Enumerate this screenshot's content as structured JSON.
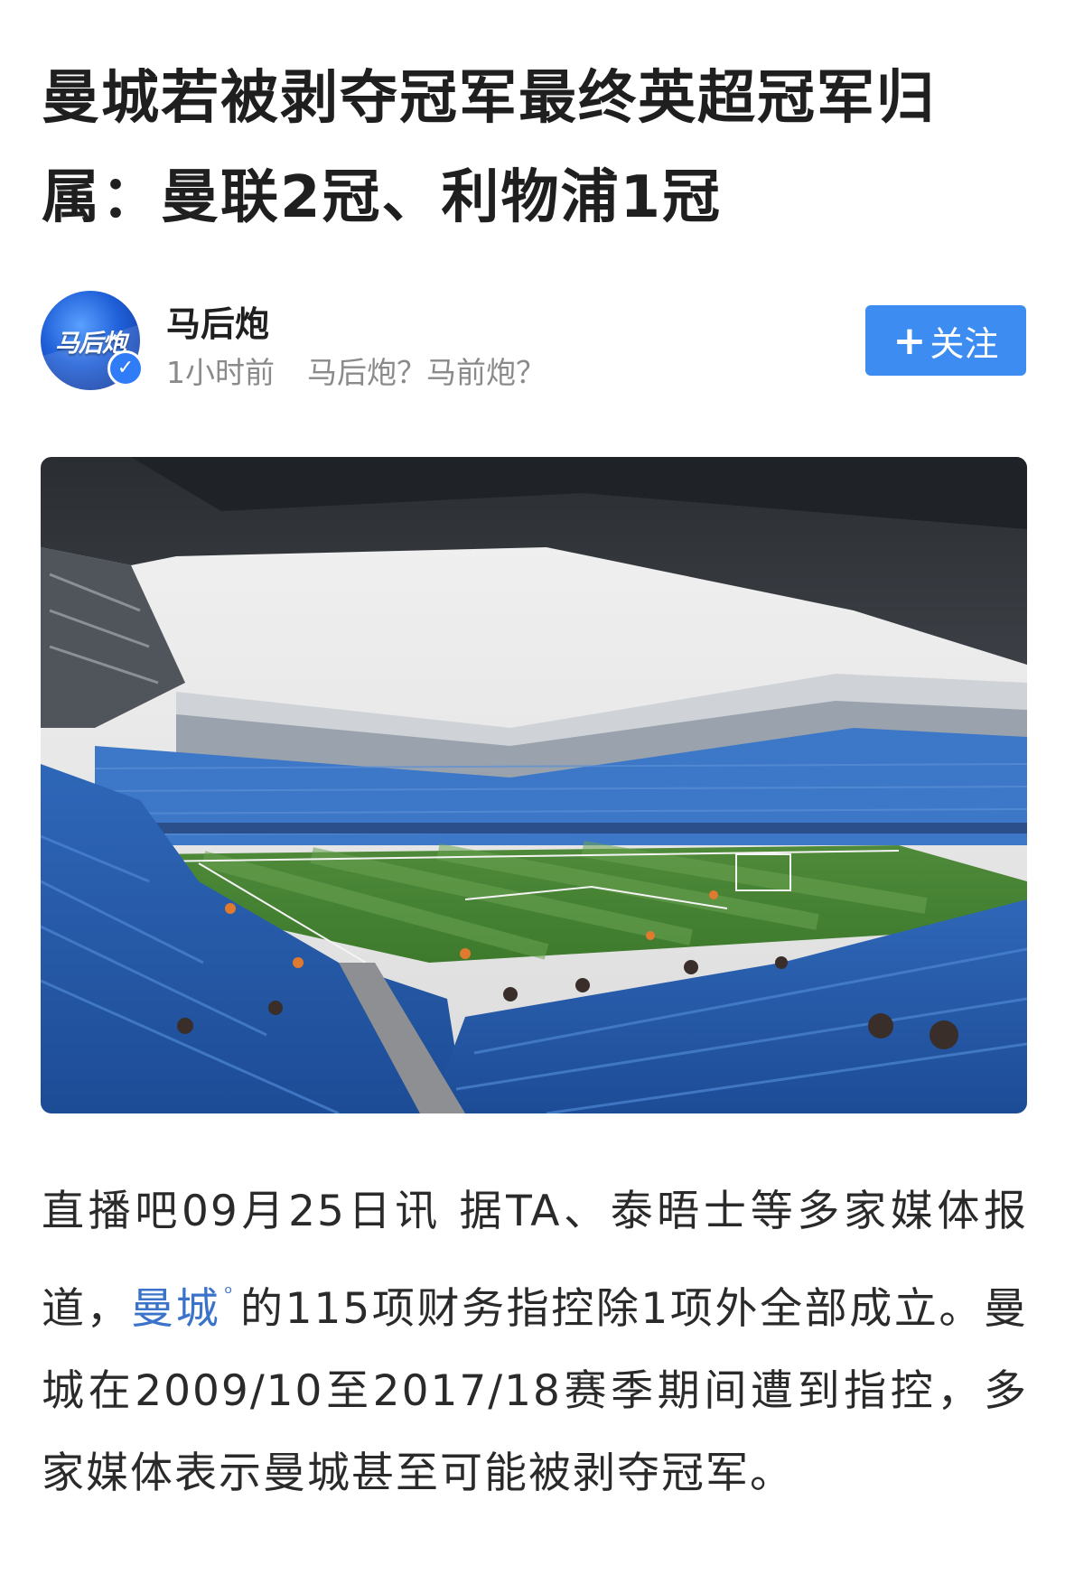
{
  "article": {
    "title": "曼城若被剥夺冠军最终英超冠军归属：曼联2冠、利物浦1冠"
  },
  "author": {
    "avatar_text": "马后炮",
    "name": "马后炮",
    "time": "1小时前",
    "signature": "马后炮？马前炮？",
    "verified_icon": "verified-check-icon"
  },
  "follow": {
    "plus": "+",
    "label": "关注"
  },
  "photo": {
    "subject": "football stadium interior"
  },
  "body": {
    "part1": "直播吧09月25日讯 据TA、泰晤士等多家媒体报道，",
    "entity": "曼城",
    "search_icon": "ᵒ",
    "part2": "的115项财务指控除1项外全部成立。曼城在2009/10至2017/18赛季期间遭到指控，多家媒体表示曼城甚至可能被剥夺冠军。"
  },
  "colors": {
    "follow_button": "#3d8cf2",
    "link": "#3a73c9",
    "meta": "#8a8a8a"
  }
}
